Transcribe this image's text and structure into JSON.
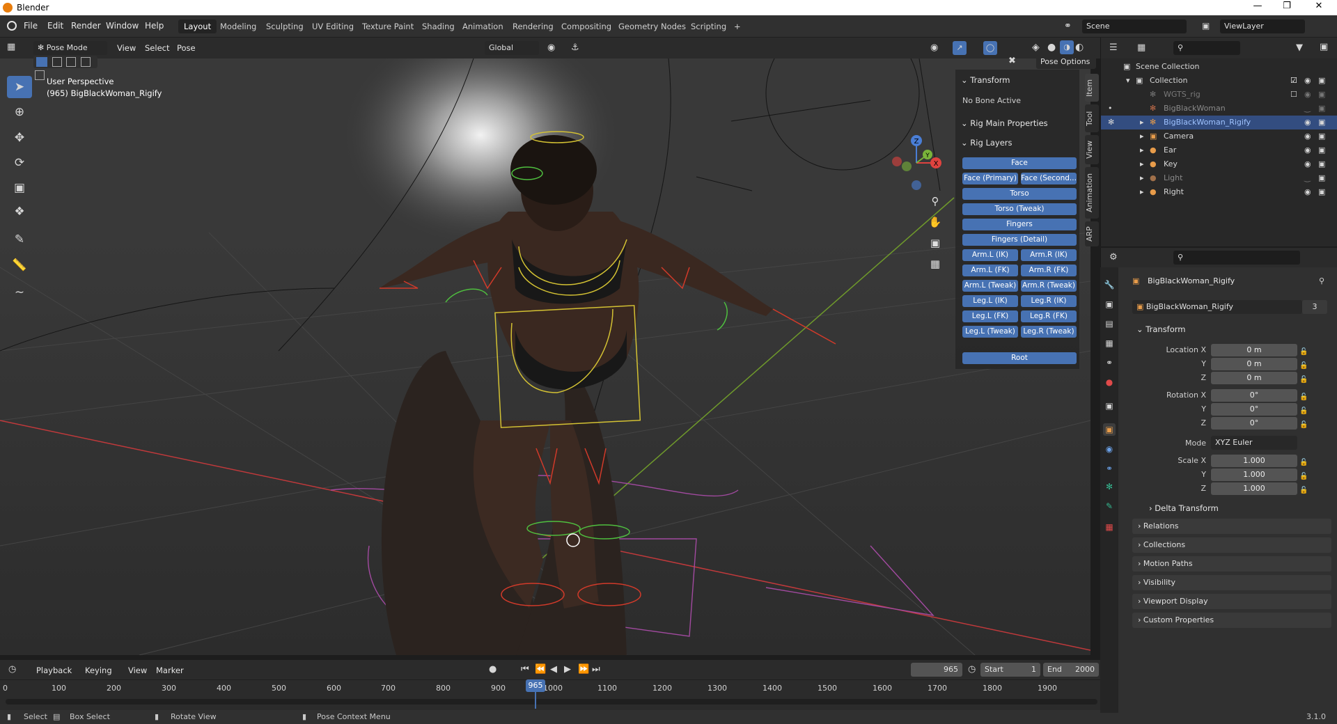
{
  "app": {
    "title": "Blender",
    "brand_color": "#e87d0d",
    "accent": "#4772b3"
  },
  "menu": [
    "File",
    "Edit",
    "Render",
    "Window",
    "Help"
  ],
  "workspaces": [
    "Layout",
    "Modeling",
    "Sculpting",
    "UV Editing",
    "Texture Paint",
    "Shading",
    "Animation",
    "Rendering",
    "Compositing",
    "Geometry Nodes",
    "Scripting"
  ],
  "workspace_add": "+",
  "scene": "Scene",
  "view_layer": "ViewLayer",
  "viewport": {
    "mode": "Pose Mode",
    "menus": [
      "View",
      "Select",
      "Pose"
    ],
    "orientation": "Global",
    "pose_options": "Pose Options",
    "overlay_title": "User Perspective",
    "overlay_object": "(965) BigBlackWoman_Rigify",
    "gizmo_axes": {
      "x": "X",
      "y": "Y",
      "z": "Z"
    }
  },
  "tools": [
    "select-box-icon",
    "cursor-icon",
    "move-icon",
    "rotate-icon",
    "scale-icon",
    "transform-icon",
    "annotate-icon",
    "measure-icon",
    "relax-icon"
  ],
  "npanel": {
    "transform_header": "Transform",
    "no_bone": "No Bone Active",
    "rig_main": "Rig Main Properties",
    "rig_layers": "Rig Layers",
    "buttons": {
      "face": "Face",
      "face_primary": "Face (Primary)",
      "face_secondary": "Face (Second...",
      "torso": "Torso",
      "torso_tweak": "Torso (Tweak)",
      "fingers": "Fingers",
      "fingers_detail": "Fingers (Detail)",
      "arm_l_ik": "Arm.L (IK)",
      "arm_r_ik": "Arm.R (IK)",
      "arm_l_fk": "Arm.L (FK)",
      "arm_r_fk": "Arm.R (FK)",
      "arm_l_tweak": "Arm.L (Tweak)",
      "arm_r_tweak": "Arm.R (Tweak)",
      "leg_l_ik": "Leg.L (IK)",
      "leg_r_ik": "Leg.R (IK)",
      "leg_l_fk": "Leg.L (FK)",
      "leg_r_fk": "Leg.R (FK)",
      "leg_l_tweak": "Leg.L (Tweak)",
      "leg_r_tweak": "Leg.R (Tweak)",
      "root": "Root"
    },
    "tabs": [
      "Item",
      "Tool",
      "View",
      "Animation",
      "ARP"
    ]
  },
  "outliner": {
    "scene_collection": "Scene Collection",
    "rows": [
      {
        "label": "Collection",
        "color": "#e0e0e0"
      },
      {
        "label": "WGTS_rig",
        "color": "#7a7a7a"
      },
      {
        "label": "BigBlackWoman",
        "color": "#8a8a8a"
      },
      {
        "label": "BigBlackWoman_Rigify",
        "color": "#9fc3ff"
      },
      {
        "label": "Camera",
        "color": "#e0e0e0"
      },
      {
        "label": "Ear",
        "color": "#e0e0e0"
      },
      {
        "label": "Key",
        "color": "#e0e0e0"
      },
      {
        "label": "Light",
        "color": "#8a8a8a"
      },
      {
        "label": "Right",
        "color": "#e0e0e0"
      }
    ]
  },
  "properties": {
    "object_name": "BigBlackWoman_Rigify",
    "data_name": "BigBlackWoman_Rigify",
    "users": "3",
    "transform": "Transform",
    "location": {
      "label_x": "Location X",
      "label_y": "Y",
      "label_z": "Z",
      "x": "0 m",
      "y": "0 m",
      "z": "0 m"
    },
    "rotation": {
      "label_x": "Rotation X",
      "label_y": "Y",
      "label_z": "Z",
      "x": "0°",
      "y": "0°",
      "z": "0°"
    },
    "mode_label": "Mode",
    "mode": "XYZ Euler",
    "scale": {
      "label_x": "Scale X",
      "label_y": "Y",
      "label_z": "Z",
      "x": "1.000",
      "y": "1.000",
      "z": "1.000"
    },
    "delta": "Delta Transform",
    "panels": [
      "Relations",
      "Collections",
      "Motion Paths",
      "Visibility",
      "Viewport Display",
      "Custom Properties"
    ]
  },
  "timeline": {
    "menus": [
      "Playback",
      "Keying",
      "View",
      "Marker"
    ],
    "current_frame": "965",
    "start_label": "Start",
    "start": "1",
    "end_label": "End",
    "end": "2000",
    "ticks": [
      "0",
      "100",
      "200",
      "300",
      "400",
      "500",
      "600",
      "700",
      "800",
      "900",
      "1000",
      "1100",
      "1200",
      "1300",
      "1400",
      "1500",
      "1600",
      "1700",
      "1800",
      "1900"
    ]
  },
  "status": {
    "select": "Select",
    "box_select": "Box Select",
    "rotate": "Rotate View",
    "context": "Pose Context Menu",
    "version": "3.1.0"
  }
}
